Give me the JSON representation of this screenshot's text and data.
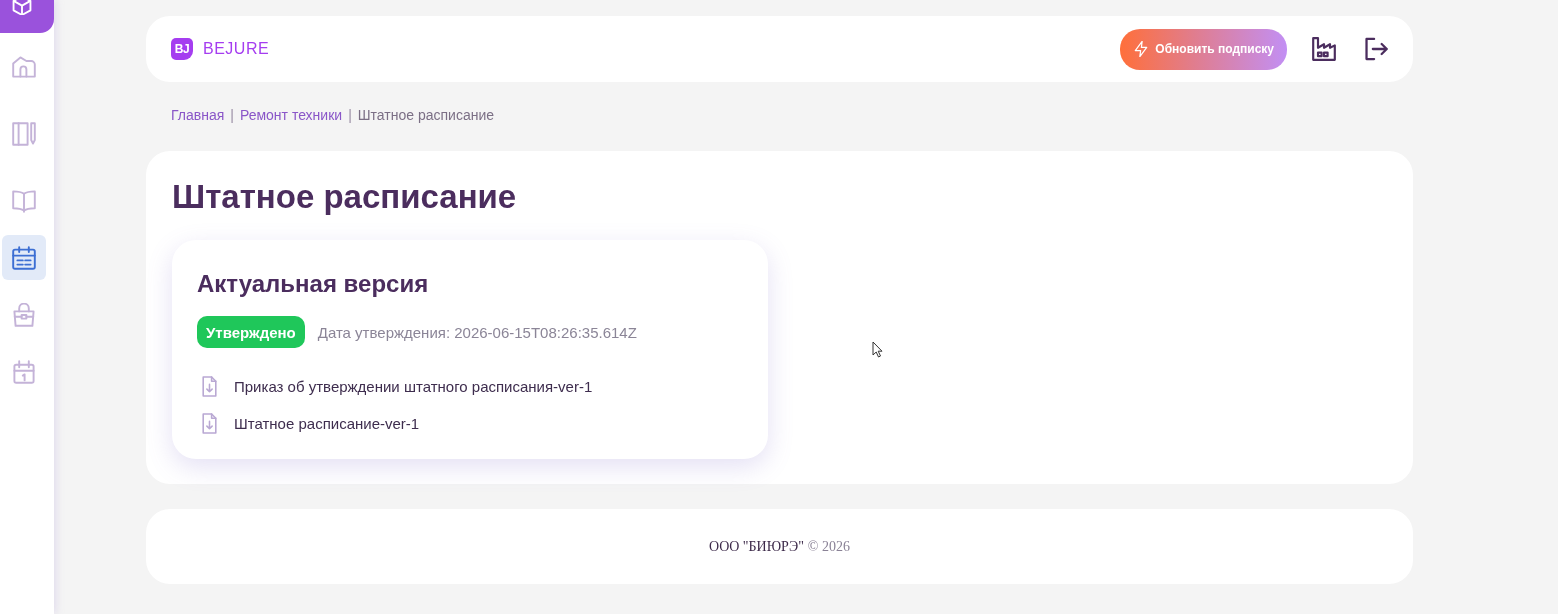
{
  "sidebar": {
    "items": [
      {
        "selected": false
      },
      {
        "selected": false
      },
      {
        "selected": false
      },
      {
        "selected": true
      },
      {
        "selected": false
      },
      {
        "selected": false
      }
    ]
  },
  "header": {
    "logo": {
      "mark": "BJ",
      "name": "BEJURE"
    },
    "upgrade_button": {
      "label": "Обновить подписку"
    }
  },
  "breadcrumbs": [
    {
      "kind": "link",
      "label": "Главная"
    },
    {
      "kind": "separator",
      "label": "|"
    },
    {
      "kind": "link",
      "label": "Ремонт техники"
    },
    {
      "kind": "separator",
      "label": "|"
    },
    {
      "kind": "current",
      "label": "Штатное расписание"
    }
  ],
  "page": {
    "title": "Штатное расписание",
    "version_card": {
      "title": "Актуальная версия",
      "status": {
        "kind": "approved",
        "label": "Утверждено"
      },
      "approval_date": "Дата утверждения: 2026-06-15T08:26:35.614Z",
      "files": [
        {
          "name": "Приказ об утверждении штатного расписания-ver-1"
        },
        {
          "name": "Штатное расписание-ver-1"
        }
      ]
    }
  },
  "footer": {
    "company": "ООО \"БИЮРЭ\"",
    "copyright": "© 2026"
  }
}
